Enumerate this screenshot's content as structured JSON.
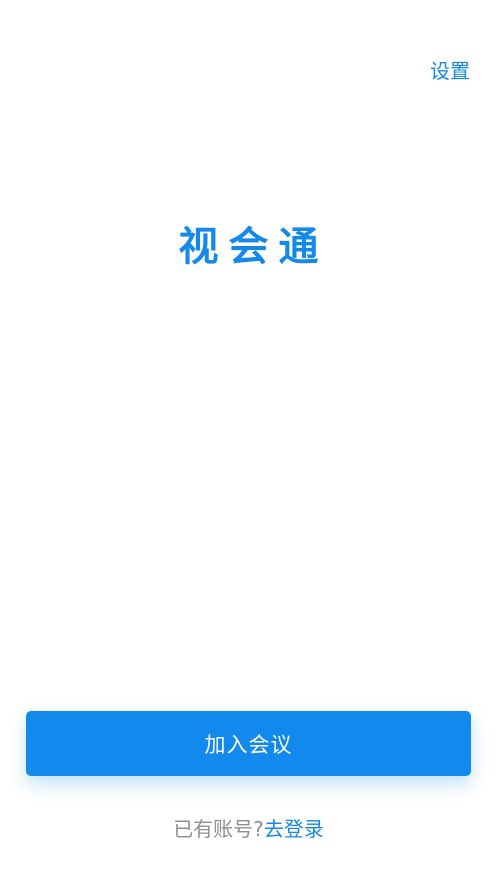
{
  "header": {
    "settings_label": "设置"
  },
  "main": {
    "app_title": "视会通"
  },
  "actions": {
    "join_meeting_label": "加入会议"
  },
  "footer": {
    "has_account_prompt": "已有账号?",
    "go_login_label": "去登录"
  },
  "colors": {
    "accent": "#1589ea",
    "button": "#1189ed",
    "muted_text": "#8f8f8f",
    "background": "#ffffff"
  }
}
